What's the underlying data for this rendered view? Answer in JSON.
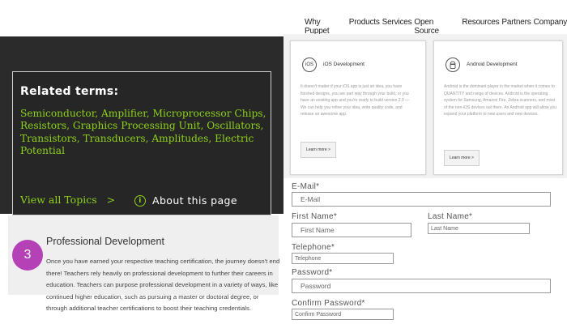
{
  "related": {
    "title": "Related terms:",
    "terms_text": "Semiconductor, Amplifier, Microprocessor Chips, Resistors, Graphics Processing Unit, Oscillators, Transistors, Transducers, Amplitudes, Electric Potential",
    "view_all": "View all Topics",
    "view_all_arrow": ">",
    "about_icon": "i",
    "about": "About this page",
    "accent_color": "#8ed11a"
  },
  "professional": {
    "step_number": "3",
    "step_color": "#b541b7",
    "title": "Professional Development",
    "body": "Once you have earned your respective teaching certification, the journey doesn't end there! Teachers rely heavily on professional development to further their careers in education. Teachers can purpose professional development in a variety of ways, like continued higher education, such as pursuing a master or doctoral degree, or through additional teacher certifications to boost their teaching credentials."
  },
  "nav": {
    "items": [
      "Why Puppet",
      "Products",
      "Services",
      "Open Source",
      "Resources",
      "Partners",
      "Company"
    ]
  },
  "cards": {
    "ios": {
      "icon": "iOS",
      "title": "iOS Development",
      "text": "It doesn't matter if your iOS app is just an idea, you have finished designs, you are part way through your build, or you have an existing app and you're ready to build version 2.0 — We can help you refine your idea, write quality code, and release an awesome app.",
      "button": "Learn more >"
    },
    "android": {
      "icon": "android-icon",
      "title": "Android Development",
      "text": "Android is the dominant player in the market when it comes to QUANTITY and range of devices. Android is the operating system for Samsung, Amazon Fire, Zebra scanners, and most of the non-iOS devices out there. An Android app will allow you expand your platform to new users and new devices.",
      "button": "Learn more >"
    }
  },
  "form": {
    "email_label": "E-Mail*",
    "email_placeholder": "E-Mail",
    "first_label": "First Name*",
    "first_placeholder": "First Name",
    "last_label": "Last Name*",
    "last_placeholder": "Last Name",
    "telephone_label": "Telephone*",
    "telephone_placeholder": "Telephone",
    "password_label": "Password*",
    "password_placeholder": "Password",
    "confirm_label": "Confirm Password*",
    "confirm_placeholder": "Confirm Password"
  }
}
